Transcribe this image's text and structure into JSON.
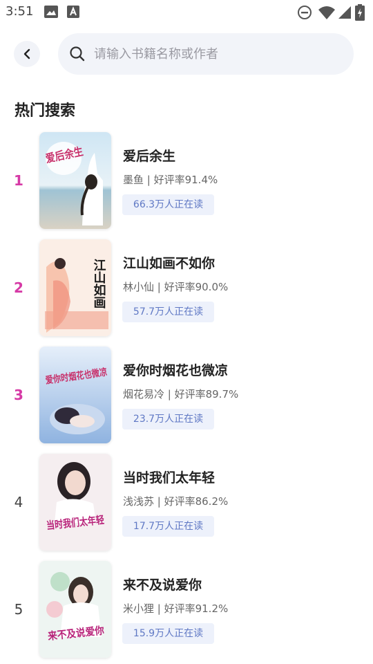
{
  "status_bar": {
    "time": "3:51",
    "icons": [
      "image-icon",
      "a-letter-icon",
      "do-not-disturb-icon",
      "wifi-icon",
      "signal-icon",
      "battery-icon"
    ]
  },
  "header": {
    "back_icon": "chevron-left-icon",
    "search": {
      "placeholder": "请输入书籍名称或作者",
      "value": ""
    }
  },
  "section": {
    "title": "热门搜索"
  },
  "colors": {
    "rank_highlight": "#d63aa6",
    "badge_bg": "#edf1fb",
    "badge_text": "#5f78c4",
    "search_bg": "#f2f4f9"
  },
  "books": [
    {
      "rank": "1",
      "title": "爱后余生",
      "meta": "墨鱼 | 好评率91.4%",
      "readers": "66.3万人正在读",
      "cover_text": "爱后余生"
    },
    {
      "rank": "2",
      "title": "江山如画不如你",
      "meta": "林小仙 | 好评率90.0%",
      "readers": "57.7万人正在读",
      "cover_text": "江山如画"
    },
    {
      "rank": "3",
      "title": "爱你时烟花也微凉",
      "meta": "烟花易冷 | 好评率89.7%",
      "readers": "23.7万人正在读",
      "cover_text": "爱你时烟花也微凉"
    },
    {
      "rank": "4",
      "title": "当时我们太年轻",
      "meta": "浅浅苏 | 好评率86.2%",
      "readers": "17.7万人正在读",
      "cover_text": "当时我们太年轻"
    },
    {
      "rank": "5",
      "title": "来不及说爱你",
      "meta": "米小狸 | 好评率91.2%",
      "readers": "15.9万人正在读",
      "cover_text": "来不及说爱你"
    }
  ]
}
